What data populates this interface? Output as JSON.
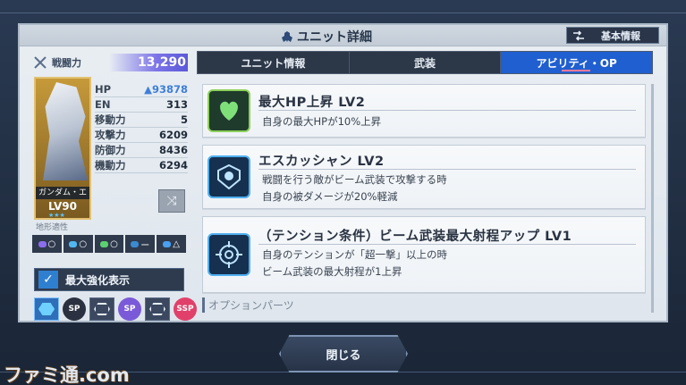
{
  "header": {
    "title": "ユニット詳細",
    "basic_info_button": "基本情報"
  },
  "unit": {
    "combat_power_label": "戦闘力",
    "combat_power_value": "13,290",
    "card_name": "ガンダム・エ",
    "card_level": "LV90",
    "stats": [
      {
        "label": "HP",
        "value": "93878",
        "highlight": true
      },
      {
        "label": "EN",
        "value": "313"
      },
      {
        "label": "移動力",
        "value": "5"
      },
      {
        "label": "攻撃力",
        "value": "6209"
      },
      {
        "label": "防御力",
        "value": "8436"
      },
      {
        "label": "機動力",
        "value": "6294"
      }
    ],
    "terrain_label": "地形適性",
    "terrain": [
      {
        "icon": "space-icon",
        "grade": "○",
        "color": "#8c6cf0"
      },
      {
        "icon": "air-icon",
        "grade": "○",
        "color": "#50b8f0"
      },
      {
        "icon": "ground-icon",
        "grade": "○",
        "color": "#5ad070"
      },
      {
        "icon": "water-surface-icon",
        "grade": "ー",
        "color": "#3a8ad0"
      },
      {
        "icon": "underwater-icon",
        "grade": "△",
        "color": "#4aa0f0"
      }
    ],
    "max_enhance_label": "最大強化表示",
    "chips": [
      "hexagon-icon",
      "sp-badge-icon",
      "hexagon-icon",
      "sp-badge-icon",
      "hexagon-icon",
      "ssp-badge-icon"
    ],
    "chip_labels": [
      "SP",
      "SP",
      "SSP"
    ]
  },
  "tabs": [
    {
      "label": "ユニット情報",
      "active": false
    },
    {
      "label": "武装",
      "active": false
    },
    {
      "label": "アビリティ・OP",
      "active": true
    }
  ],
  "abilities": [
    {
      "title": "最大HP上昇 LV2",
      "desc": [
        "自身の最大HPが10%上昇"
      ],
      "icon": "heart-icon"
    },
    {
      "title": "エスカッシャン LV2",
      "desc": [
        "戦闘を行う敵がビーム武装で攻撃する時",
        "自身の被ダメージが20%軽減"
      ],
      "icon": "shield-icon"
    },
    {
      "title": "（テンション条件）ビーム武装最大射程アップ LV1",
      "desc": [
        "自身のテンションが「超一撃」以上の時",
        "ビーム武装の最大射程が1上昇"
      ],
      "icon": "crosshair-icon"
    }
  ],
  "option_parts_label": "オプションパーツ",
  "close_label": "閉じる",
  "watermark": "ファミ通.com"
}
